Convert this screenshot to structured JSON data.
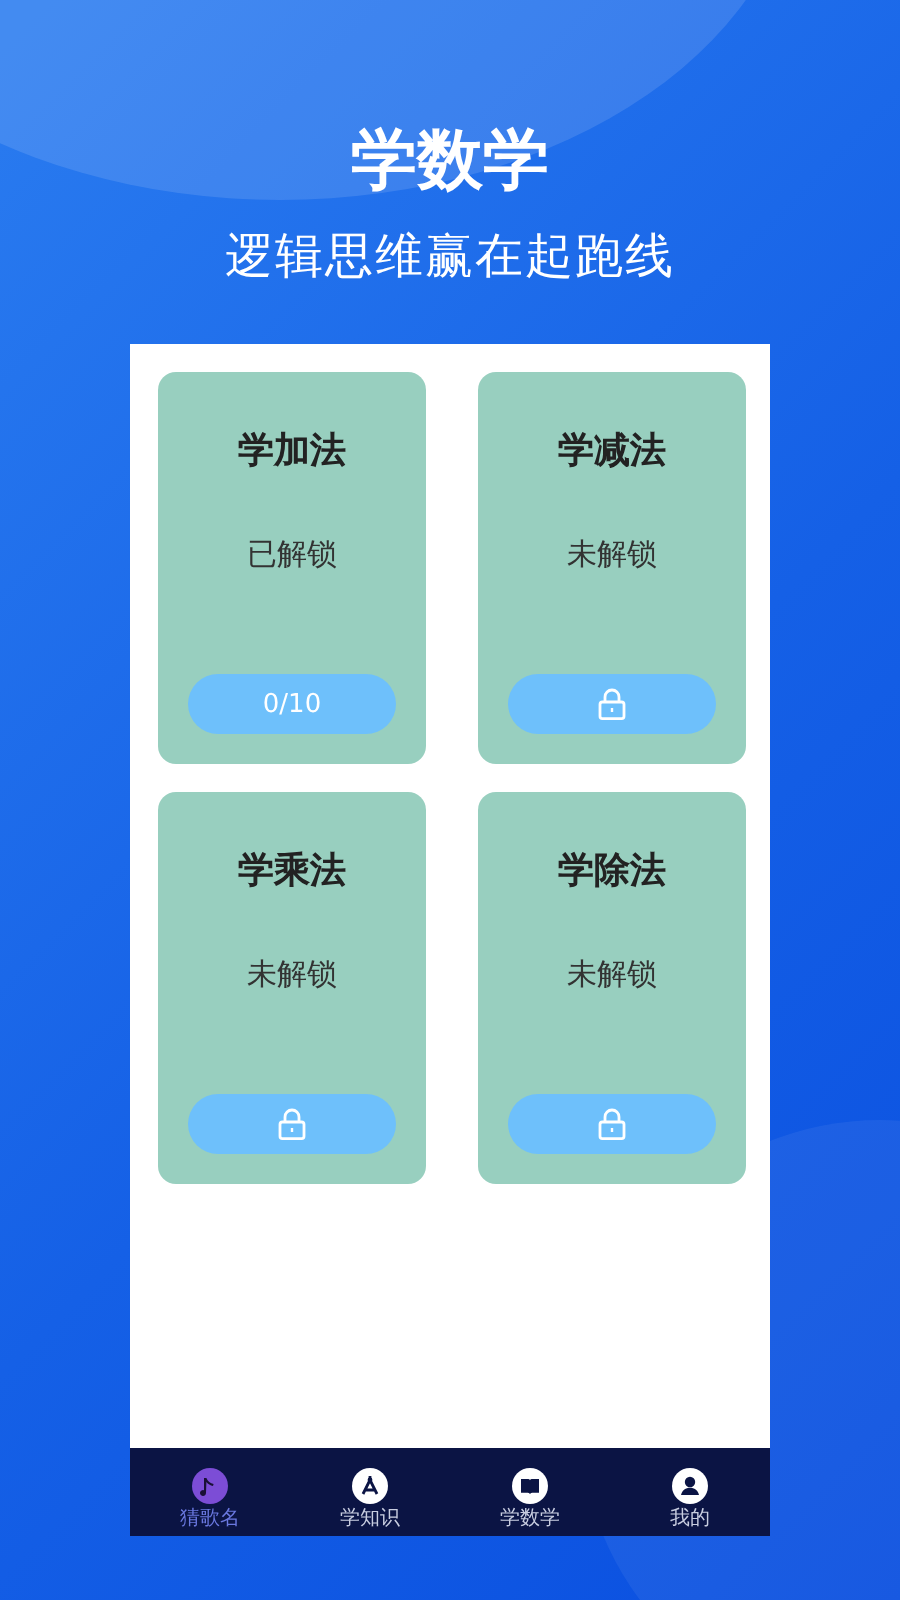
{
  "header": {
    "title": "学数学",
    "subtitle": "逻辑思维赢在起跑线"
  },
  "cards": [
    {
      "kind": "progress",
      "title": "学加法",
      "status": "已解锁",
      "progress": "0/10"
    },
    {
      "kind": "locked",
      "title": "学减法",
      "status": "未解锁"
    },
    {
      "kind": "locked",
      "title": "学乘法",
      "status": "未解锁"
    },
    {
      "kind": "locked",
      "title": "学除法",
      "status": "未解锁"
    }
  ],
  "tabs": [
    {
      "label": "猜歌名",
      "selected": true
    },
    {
      "label": "学知识",
      "selected": false
    },
    {
      "label": "学数学",
      "selected": false
    },
    {
      "label": "我的",
      "selected": false
    }
  ]
}
